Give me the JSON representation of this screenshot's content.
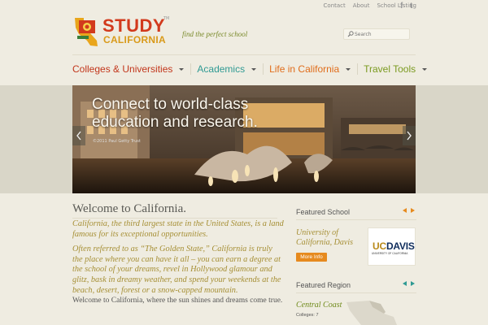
{
  "top_links": [
    "Contact",
    "About",
    "School Listing"
  ],
  "social": {
    "facebook_glyph": "f",
    "twitter_glyph": "t"
  },
  "logo": {
    "line1": "STUDY",
    "line2": "CALIFORNIA",
    "tm": "TM"
  },
  "tagline": "find the perfect school",
  "search": {
    "placeholder": "Search"
  },
  "nav": [
    {
      "label": "Colleges & Universities",
      "color": "#c2361b"
    },
    {
      "label": "Academics",
      "color": "#2f9a93"
    },
    {
      "label": "Life in California",
      "color": "#e06d1b"
    },
    {
      "label": "Travel Tools",
      "color": "#7a9a1f"
    }
  ],
  "hero": {
    "headline": "Connect to world-class education and research.",
    "credit": "©2011 Paul Getty Trust"
  },
  "welcome": {
    "title": "Welcome to California.",
    "intro1": "California, the third largest state in the United States, is a land famous for its exceptional opportunities.",
    "intro2": "Often referred to as “The Golden State,” California is truly the place where you can have it all – you can earn a degree at the school of your dreams, revel in Hollywood glamour and glitz, bask in dreamy weather, and spend your weekends at the beach, desert, forest or a snow-capped mountain.",
    "closing": "Welcome to California, where the sun shines and dreams come true."
  },
  "featured_school": {
    "heading": "Featured School",
    "name": "University of California, Davis",
    "button": "More Info",
    "logo_uc": "UC",
    "logo_davis": "DAVIS",
    "logo_sub": "UNIVERSITY OF CALIFORNIA"
  },
  "featured_region": {
    "heading": "Featured Region",
    "name": "Central Coast",
    "count": "Colleges: 7"
  },
  "colors": {
    "school_arrow": "#e68a1e",
    "region_arrow": "#2f9a93",
    "accent_gold": "#a68f35"
  }
}
